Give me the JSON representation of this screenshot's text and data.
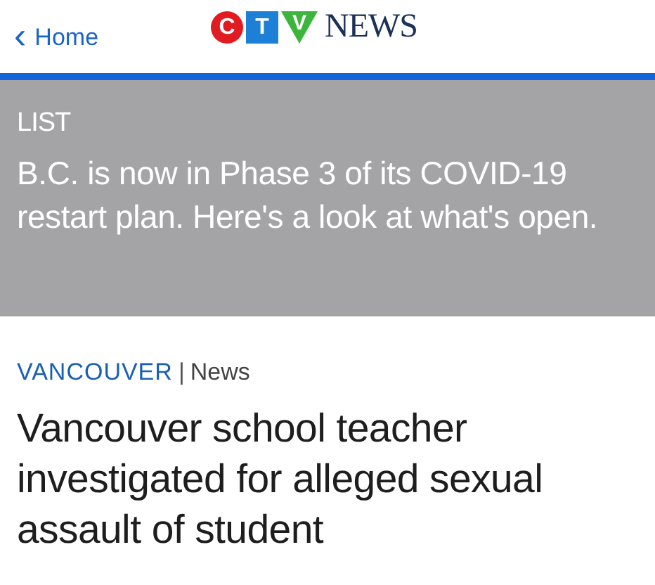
{
  "header": {
    "back_link": {
      "chevron": "‹",
      "label": "Home"
    },
    "logo": {
      "letters": [
        {
          "char": "C",
          "color": "#e01b22"
        },
        {
          "char": "T",
          "color": "#1e7fd6"
        },
        {
          "char": "V",
          "color": "#3cb53c"
        }
      ],
      "wordmark": "NEWS"
    }
  },
  "promo": {
    "label": "LIST",
    "headline": "B.C. is now in Phase 3 of its COVID-19 restart plan. Here's a look at what's open."
  },
  "article": {
    "section": "VANCOUVER",
    "separator": "|",
    "category": "News",
    "headline": "Vancouver school teacher investigated for alleged sexual assault of student"
  }
}
